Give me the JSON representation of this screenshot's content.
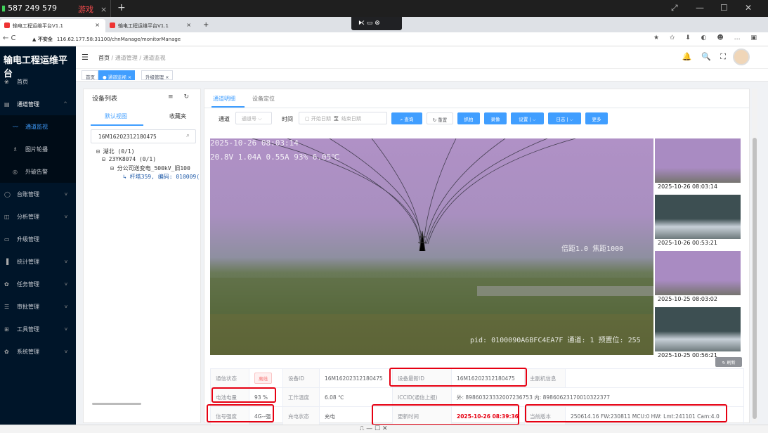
{
  "taskbar": {
    "phone": "587 249 579",
    "game_tab": "游戏",
    "close": "×",
    "new_tab": "+",
    "min": "—",
    "max": "☐",
    "close_win": "✕",
    "restore": "⤢"
  },
  "browser_tabs": [
    {
      "label": "输电工程运维平台V1.1",
      "close": "×"
    },
    {
      "label": "输电工程运维平台V1.1",
      "close": "×"
    }
  ],
  "cast_bar": "⧔  ▭  ⊗",
  "address": {
    "nav": "← C",
    "warn": "▲ 不安全",
    "url": "116.62.177.58:31100/chnManage/monitorManage",
    "icons": "★ ✩ ⬇ ◐ ☻ … ▣"
  },
  "sidebar": {
    "logo": "输电工程运维平台",
    "items": [
      {
        "icon": "❀",
        "label": "首页",
        "arrow": ""
      },
      {
        "icon": "▤",
        "label": "通道管理",
        "arrow": "^"
      },
      {
        "icon": "〰",
        "label": "通道监视",
        "arrow": ""
      },
      {
        "icon": "♗",
        "label": "图片轮播",
        "arrow": ""
      },
      {
        "icon": "◎",
        "label": "外破告警",
        "arrow": ""
      },
      {
        "icon": "◯",
        "label": "台账管理",
        "arrow": "v"
      },
      {
        "icon": "◫",
        "label": "分析管理",
        "arrow": "v"
      },
      {
        "icon": "▭",
        "label": "升级管理",
        "arrow": ""
      },
      {
        "icon": "▐",
        "label": "统计管理",
        "arrow": "v"
      },
      {
        "icon": "✿",
        "label": "任务管理",
        "arrow": "v"
      },
      {
        "icon": "☰",
        "label": "审批管理",
        "arrow": "v"
      },
      {
        "icon": "⊞",
        "label": "工具管理",
        "arrow": "v"
      },
      {
        "icon": "✿",
        "label": "系统管理",
        "arrow": "v"
      }
    ]
  },
  "header": {
    "menu_icon": "☰",
    "crumb_home": "首页",
    "crumb_sep": " / ",
    "crumb_1": "通道管理",
    "crumb_2": "通道监视",
    "tools": "🔔 🔍 ⛶"
  },
  "tags": [
    {
      "label": "首页"
    },
    {
      "label": "● 通道监视 ×"
    },
    {
      "label": "升级管理 ×"
    }
  ],
  "device_panel": {
    "title": "设备列表",
    "tools": "≡ ↻",
    "tab_default": "默认视图",
    "tab_fav": "收藏夹",
    "search_value": "16M16202312180475",
    "search_icon": "⌕",
    "tree": [
      "⊟ 湖北 (0/1)",
      "⊟ 23YK8074 (0/1)",
      "⊟ 分公司送变电_500kV_旧100",
      "↳ 杆塔359, 编码: 010009("
    ]
  },
  "main": {
    "tab_detail": "通道明细",
    "tab_locate": "设备定位",
    "channel_label": "通道",
    "channel_placeholder": "通道号  ⌵",
    "time_label": "时间",
    "start_placeholder": "▢  开始日期",
    "to": "至",
    "end_placeholder": "结束日期",
    "buttons": [
      "⌕ 查询",
      "↻ 重置",
      "抓拍",
      "录像",
      "设置  |  ⌵",
      "日志  |  ⌵",
      "更多"
    ],
    "osd_time": "2025-10-26 08:03:14",
    "osd_stats": "20.8V 1.04A 0.55A 93% 6.05℃",
    "osd_zoom": "倍距1.0 焦距1000",
    "osd_pid": "pid: 0100090A6BFC4EA7F 通道: 1 预置位: 255",
    "thumbs": [
      "2025-10-26 08:03:14",
      "2025-10-26 00:53:21",
      "2025-10-25 08:03:02",
      "2025-10-25 00:56:21"
    ],
    "refresh": "↻ 刷新"
  },
  "info": {
    "comm_status_k": "通信状态",
    "comm_status_v": "离线",
    "device_id_k": "设备ID",
    "device_id_v": "16M16202312180475",
    "latest_id_k": "设备最新ID",
    "latest_id_v": "16M16202312180475",
    "host_k": "主副机信息",
    "host_v": "",
    "battery_k": "电池电量",
    "battery_v": "93 %",
    "temp_k": "工作温度",
    "temp_v": "6.08 ℃",
    "iccid_k": "ICCID(通信上报)",
    "iccid_v": "外: 89860323332007236753 内: 89860623170010322377",
    "signal_k": "信号强度",
    "signal_v": "4G--强",
    "charge_k": "充电状态",
    "charge_v": "充电",
    "update_k": "更新时间",
    "update_v": "2025-10-26 08:39:36",
    "version_k": "当前版本",
    "version_v": "250614.16 FW:230811 MCU:0 HW: Lmt:241101 Cam:4.0"
  },
  "bottom_icons": "⎍   —   ☐   ✕"
}
